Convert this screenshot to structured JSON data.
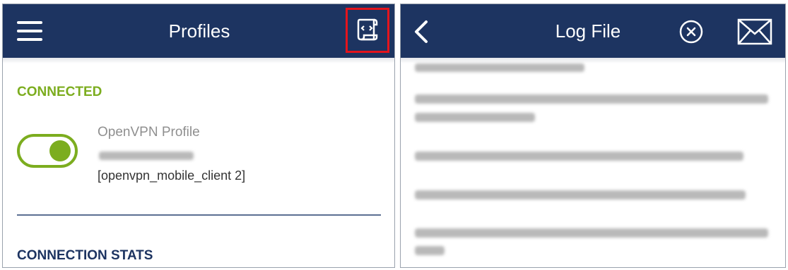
{
  "left_panel": {
    "header": {
      "title": "Profiles",
      "menu_icon": "hamburger-menu-icon",
      "log_icon": "log-file-icon"
    },
    "connected_label": "CONNECTED",
    "profile": {
      "name": "OpenVPN Profile",
      "client": "[openvpn_mobile_client 2]",
      "toggle_on": true
    },
    "stats_label": "CONNECTION STATS",
    "colors": {
      "accent_green": "#7cad1f",
      "header_blue": "#1d3461",
      "highlight_red": "#e4141c"
    }
  },
  "right_panel": {
    "header": {
      "title": "Log File",
      "back_icon": "chevron-left-icon",
      "clear_icon": "close-circle-icon",
      "mail_icon": "mail-icon"
    }
  }
}
